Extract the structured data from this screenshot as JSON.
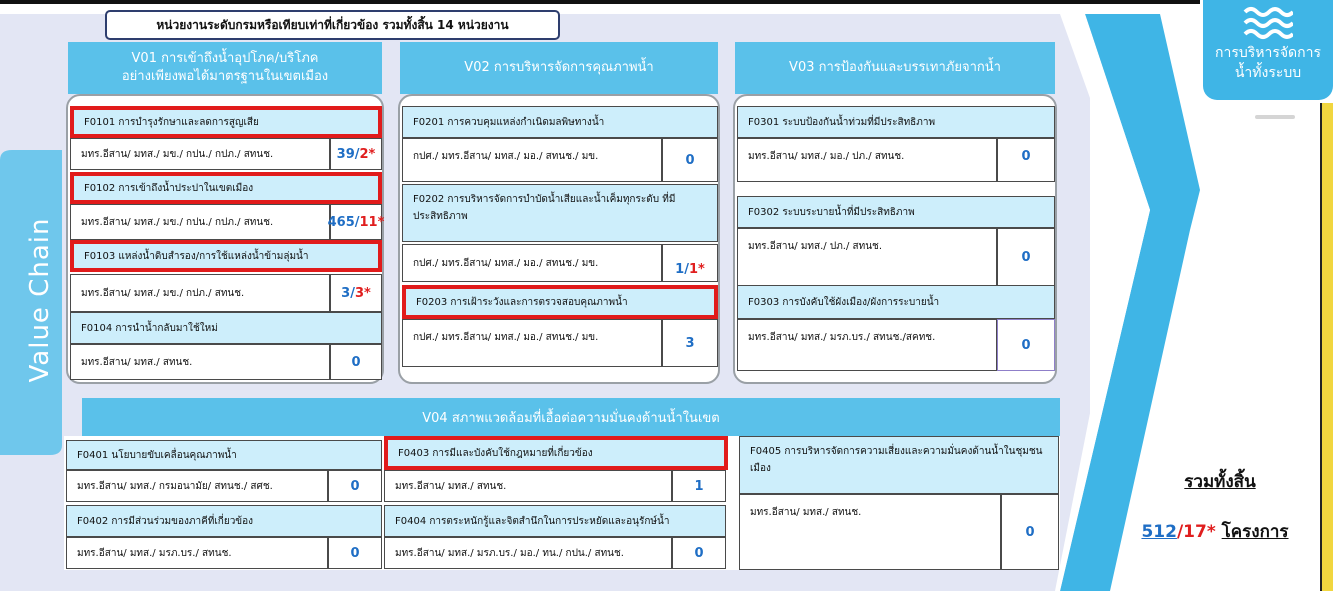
{
  "header": "หน่วยงานระดับกรมหรือเทียบเท่าที่เกี่ยวข้อง  รวมทั้งสิ้น 14 หน่วยงาน",
  "value_chain_label": "Value Chain",
  "logo": {
    "line1": "การบริหารจัดการ",
    "line2": "น้ำทั้งระบบ",
    "icon": "water-waves-icon"
  },
  "colors": {
    "accent": "#5ac1ea",
    "item_bg": "#cdeefb",
    "highlight": "#e11b1b",
    "count_blue": "#1f6ec5",
    "count_red": "#e01e1e",
    "yellow_bar": "#f1d63f"
  },
  "v01": {
    "line1": "V01 การเข้าถึงน้ำอุปโภค/บริโภค",
    "line2": "อย่างเพียงพอได้มาตรฐานในเขตเมือง",
    "items": [
      {
        "title": "F0101 การบำรุงรักษาและลดการสูญเสีย",
        "units": "มทร.อีสาน/ มทส./ มข./ กปน./ กปภ./ สทนช.",
        "count_a": "39/",
        "count_b": "2*"
      },
      {
        "title": "F0102 การเข้าถึงน้ำประปาในเขตเมือง",
        "units": "มทร.อีสาน/ มทส./ มข./ กปน./ กปภ./ สทนช.",
        "count_a": "465/",
        "count_b": "11*"
      },
      {
        "title": "F0103 แหล่งน้ำดิบสำรอง/การใช้แหล่งน้ำข้ามลุ่มน้ำ",
        "units": "มทร.อีสาน/ มทส./ มข./ กปภ./ สทนช.",
        "count_a": "3/",
        "count_b": "3*"
      },
      {
        "title": "F0104 การนำน้ำกลับมาใช้ใหม่",
        "units": "มทร.อีสาน/ มทส./ สทนช.",
        "count_a": "0",
        "count_b": ""
      }
    ]
  },
  "v02": {
    "title": "V02 การบริหารจัดการคุณภาพน้ำ",
    "items": [
      {
        "title": "F0201 การควบคุมแหล่งกำเนิดมลพิษทางน้ำ",
        "units": "กปศ./ มทร.อีสาน/ มทส./ มอ./ สทนช./ มข.",
        "count_a": "0",
        "count_b": ""
      },
      {
        "title": "F0202 การบริหารจัดการบำบัดน้ำเสียและน้ำเค็มทุกระดับ ที่มีประสิทธิภาพ",
        "units": "กปศ./ มทร.อีสาน/ มทส./ มอ./ สทนช./ มข.",
        "count_a": "1/",
        "count_b": "1*"
      },
      {
        "title": "F0203 การเฝ้าระวังและการตรวจสอบคุณภาพน้ำ",
        "units": "กปศ./ มทร.อีสาน/ มทส./ มอ./ สทนช./ มข.",
        "count_a": "3",
        "count_b": ""
      }
    ]
  },
  "v03": {
    "title": "V03 การป้องกันและบรรเทาภัยจากน้ำ",
    "items": [
      {
        "title": "F0301 ระบบป้องกันน้ำท่วมที่มีประสิทธิภาพ",
        "units": "มทร.อีสาน/ มทส./ มอ./ ปภ./ สทนช.",
        "count_a": "0",
        "count_b": ""
      },
      {
        "title": "F0302 ระบบระบายน้ำที่มีประสิทธิภาพ",
        "units": "มทร.อีสาน/ มทส./ ปภ./ สทนช.",
        "count_a": "0",
        "count_b": ""
      },
      {
        "title": "F0303 การบังคับใช้ผังเมือง/ผังการระบายน้ำ",
        "units": "มทร.อีสาน/ มทส./ มรภ.บร./ สทนช./สคทช.",
        "count_a": "0",
        "count_b": ""
      }
    ]
  },
  "v04": {
    "title": "V04 สภาพแวดล้อมที่เอื้อต่อความมั่นคงด้านน้ำในเขต",
    "items": [
      {
        "title": "F0401 นโยบายขับเคลื่อนคุณภาพน้ำ",
        "units": "มทร.อีสาน/ มทส./ กรมอนามัย/ สทนช./ สศช.",
        "count_a": "0"
      },
      {
        "title": "F0402 การมีส่วนร่วมของภาคีที่เกี่ยวข้อง",
        "units": "มทร.อีสาน/ มทส./ มรภ.บร./ สทนช.",
        "count_a": "0"
      },
      {
        "title": "F0403 การมีและบังคับใช้กฎหมายที่เกี่ยวข้อง",
        "units": "มทร.อีสาน/ มทส./ สทนช.",
        "count_a": "1"
      },
      {
        "title": "F0404 การตระหนักรู้และจิตสำนึกในการประหยัดและอนุรักษ์น้ำ",
        "units": "มทร.อีสาน/ มทส./ มรภ.บร./ มอ./ ทน./ กปน./ สทนช.",
        "count_a": "0"
      },
      {
        "title": "F0405 การบริหารจัดการความเสี่ยงและความมั่นคงด้านน้ำในชุมชนเมือง",
        "units": "มทร.อีสาน/ มทส./ สทนช.",
        "count_a": "0"
      }
    ]
  },
  "total": {
    "label": "รวมทั้งสิ้น",
    "a": "512",
    "b": "/17*",
    "c": "โครงการ"
  }
}
